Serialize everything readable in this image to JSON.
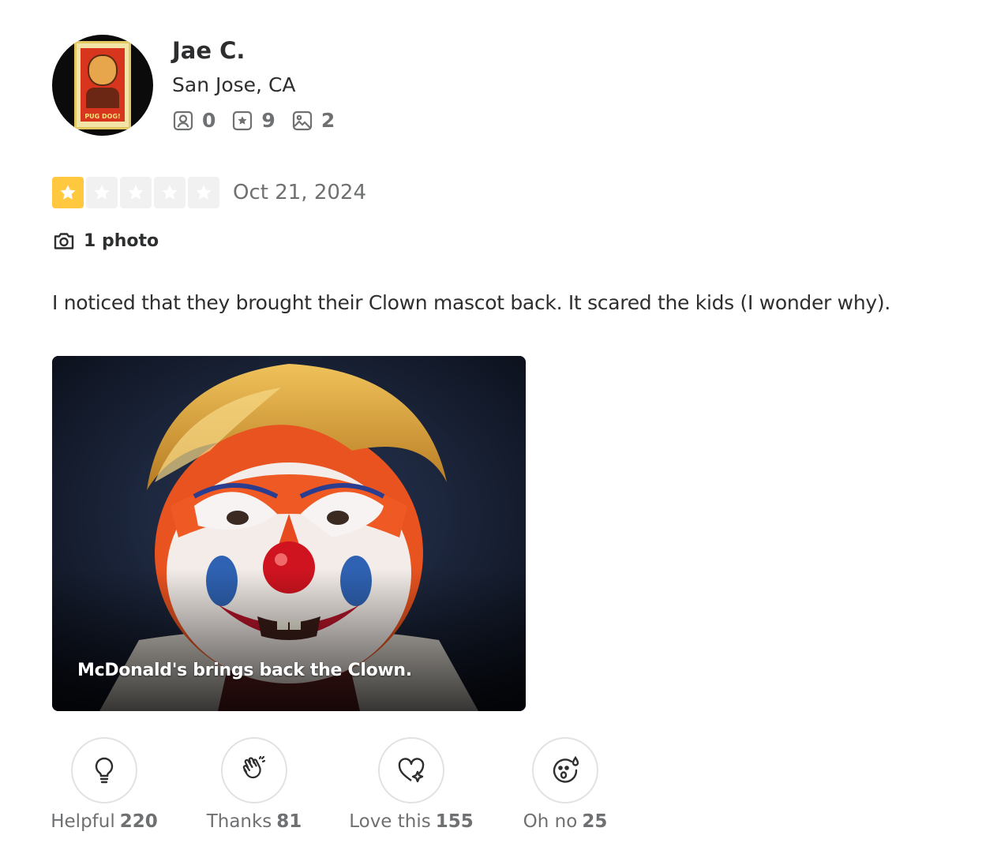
{
  "user": {
    "name": "Jae C.",
    "location": "San Jose, CA",
    "avatar_poster_text": "PUG DOG!",
    "stats": [
      {
        "icon": "friends-icon",
        "value": "0"
      },
      {
        "icon": "reviews-icon",
        "value": "9"
      },
      {
        "icon": "photos-icon",
        "value": "2"
      }
    ]
  },
  "review": {
    "rating": 1,
    "rating_max": 5,
    "date": "Oct 21, 2024",
    "photo_count_label": "1 photo",
    "text": "I noticed that they brought their Clown mascot back. It scared the kids (I wonder why).",
    "photo_caption": "McDonald's brings back the Clown."
  },
  "reactions": [
    {
      "icon": "lightbulb-icon",
      "label": "Helpful",
      "count": "220"
    },
    {
      "icon": "clapping-hands-icon",
      "label": "Thanks",
      "count": "81"
    },
    {
      "icon": "heart-sparkle-icon",
      "label": "Love this",
      "count": "155"
    },
    {
      "icon": "surprised-face-icon",
      "label": "Oh no",
      "count": "25"
    }
  ],
  "colors": {
    "star_on": "#ffc83e",
    "star_off": "#f1f1f1",
    "text": "#2d2e2f",
    "muted": "#6e7072"
  }
}
